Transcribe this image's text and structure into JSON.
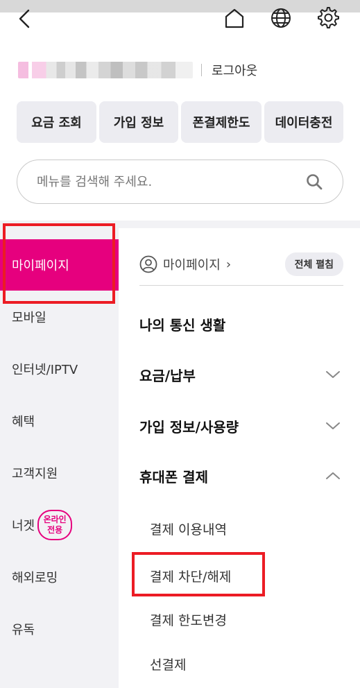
{
  "header": {
    "back_icon": "chevron-left-icon",
    "home_icon": "home-icon",
    "language_icon": "globe-icon",
    "settings_icon": "gear-icon"
  },
  "user": {
    "logout_label": "로그아웃"
  },
  "quick_menu": [
    "요금 조회",
    "가입 정보",
    "폰결제한도",
    "데이터충전"
  ],
  "search": {
    "placeholder": "메뉴를 검색해 주세요.",
    "icon": "search-icon"
  },
  "sidebar": {
    "items": [
      "마이페이지",
      "모바일",
      "인터넷/IPTV",
      "혜택",
      "고객지원",
      "너겟",
      "해외로밍",
      "유독"
    ],
    "active": "마이페이지",
    "badge_line1": "온라인",
    "badge_line2": "전용"
  },
  "main": {
    "crumb_label": "마이페이지",
    "crumb_chevron": "›",
    "expand_all_label": "전체 펼침",
    "sections": [
      {
        "label": "나의 통신 생활"
      },
      {
        "label": "요금/납부",
        "state": "collapsed"
      },
      {
        "label": "가입 정보/사용량",
        "state": "collapsed"
      },
      {
        "label": "휴대폰 결제",
        "state": "expanded"
      }
    ],
    "sub_items": [
      "결제 이용내역",
      "결제 차단/해제",
      "결제 한도변경",
      "선결제"
    ]
  },
  "colors": {
    "brand": "#e6007e",
    "highlight": "#ec1c24",
    "sidebar_bg": "#f2f2f5"
  }
}
